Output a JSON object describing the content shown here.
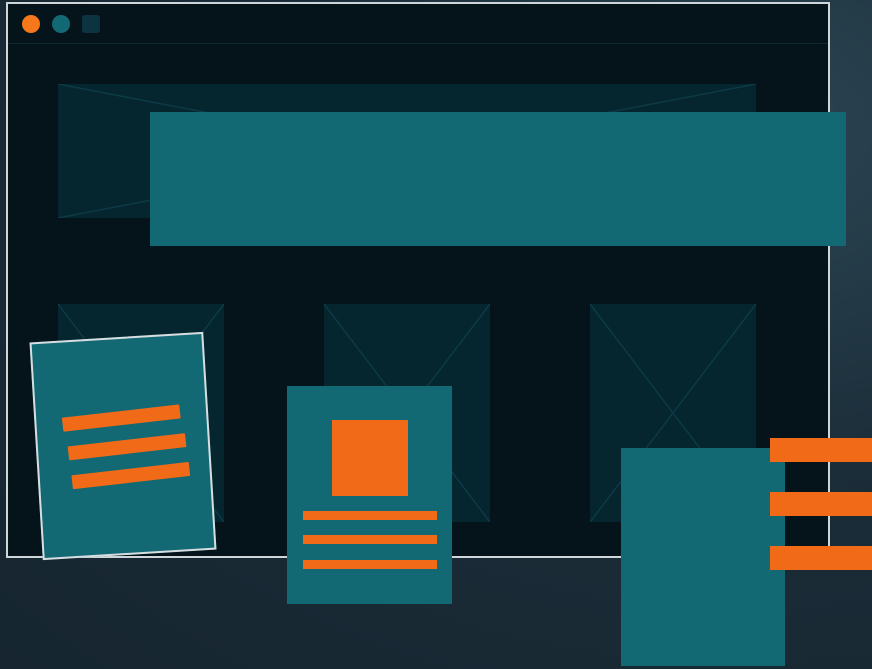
{
  "illustration": {
    "kind": "website-wireframe-mockup",
    "colors": {
      "background": "#1b2d39",
      "window": "#04141a",
      "teal": "#136973",
      "orange": "#f16a18",
      "placeholder": "#05262f",
      "outline": "#cfd6da"
    },
    "window_controls": [
      {
        "name": "close-dot",
        "color": "#f7771b"
      },
      {
        "name": "minimize-dot",
        "color": "#136973"
      },
      {
        "name": "maximize-dot",
        "color": "#0c3440"
      }
    ],
    "icons": [
      "image-placeholder-icon"
    ]
  }
}
